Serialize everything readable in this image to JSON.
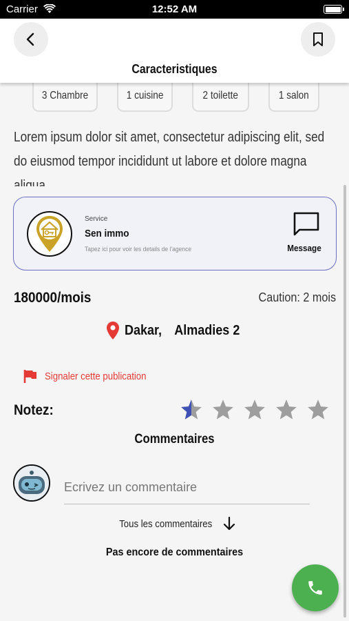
{
  "status_bar": {
    "carrier": "Carrier",
    "time": "12:52 AM"
  },
  "header": {
    "title": "Caracteristiques"
  },
  "features": [
    "3 Chambre",
    "1 cuisine",
    "2 toilette",
    "1 salon"
  ],
  "description": "Lorem ipsum dolor sit amet, consectetur adipiscing elit, sed do eiusmod tempor incididunt ut labore et dolore magna aliqua",
  "agency": {
    "service_label": "Service",
    "name": "Sen immo",
    "hint": "Tapez ici pour voir les details de l'agence",
    "message_label": "Message"
  },
  "listing": {
    "price": "180000/mois",
    "caution": "Caution: 2 mois",
    "city": "Dakar,",
    "district": "Almadies 2"
  },
  "report": {
    "label": "Signaler cette publication"
  },
  "rating": {
    "label": "Notez:",
    "value": 0.5,
    "max": 5
  },
  "comments": {
    "title": "Commentaires",
    "input_placeholder": "Ecrivez un commentaire",
    "all_label": "Tous les commentaires",
    "empty_label": "Pas encore de commentaires"
  },
  "colors": {
    "accent": "#3f51b5",
    "report": "#e53935",
    "fab": "#4caf50",
    "star_empty": "#9e9e9e"
  },
  "icons": [
    "back-icon",
    "bookmark-icon",
    "message-icon",
    "location-pin-icon",
    "flag-icon",
    "star-icon",
    "arrow-down-icon",
    "phone-icon"
  ]
}
